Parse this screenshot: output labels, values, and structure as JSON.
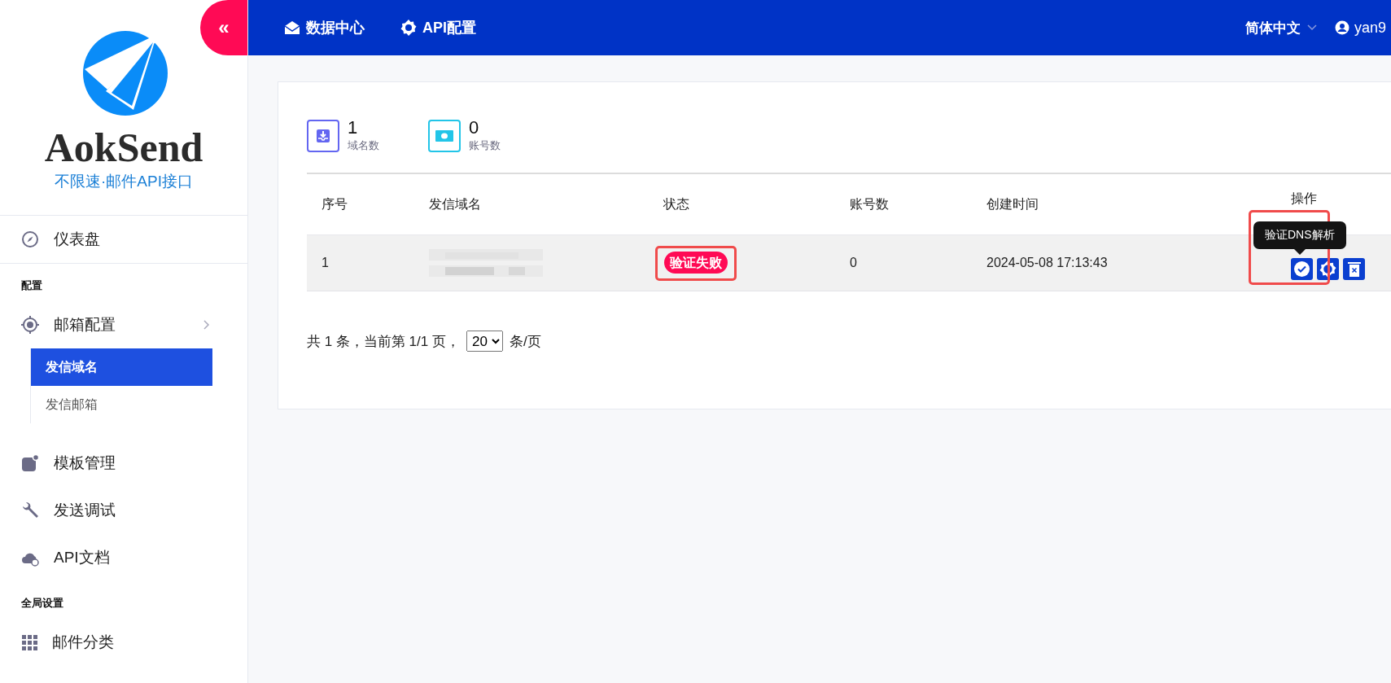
{
  "logo": {
    "name": "AokSend",
    "tagline": "不限速·邮件API接口"
  },
  "collapse_button": {
    "label": "«"
  },
  "top_nav": [
    {
      "label": "数据中心",
      "kind": "mail"
    },
    {
      "label": "API配置",
      "kind": "gear"
    }
  ],
  "language": {
    "label": "简体中文"
  },
  "user": {
    "name": "yan9"
  },
  "sidebar": [
    {
      "kind": "item",
      "label": "仪表盘",
      "bordered": true,
      "selected": false,
      "expandable": false
    },
    {
      "kind": "section",
      "label": "配置"
    },
    {
      "kind": "item",
      "label": "邮箱配置",
      "bordered": false,
      "selected": false,
      "expandable": true,
      "children": [
        {
          "label": "发信域名",
          "selected": true
        },
        {
          "label": "发信邮箱",
          "selected": false
        }
      ]
    },
    {
      "kind": "item",
      "label": "模板管理",
      "bordered": false,
      "selected": false,
      "expandable": false
    },
    {
      "kind": "item",
      "label": "发送调试",
      "bordered": false,
      "selected": false,
      "expandable": false
    },
    {
      "kind": "item",
      "label": "API文档",
      "bordered": false,
      "selected": false,
      "expandable": false
    },
    {
      "kind": "section",
      "label": "全局设置"
    },
    {
      "kind": "item",
      "label": "邮件分类",
      "bordered": false,
      "selected": false,
      "expandable": false
    }
  ],
  "stats": [
    {
      "value": "1",
      "label": "域名数",
      "kind": "inbox",
      "color": "#6366f1"
    },
    {
      "value": "0",
      "label": "账号数",
      "kind": "money",
      "color": "#22c5e8"
    }
  ],
  "table": {
    "columns": [
      "序号",
      "发信域名",
      "状态",
      "账号数",
      "创建时间",
      "操作"
    ],
    "rows": [
      {
        "index": "1",
        "status": "验证失败",
        "accounts": "0",
        "created": "2024-05-08 17:13:43"
      }
    ]
  },
  "tooltip": {
    "text": "验证DNS解析"
  },
  "pagination": {
    "summary": "共 1 条，当前第 1/1 页，",
    "page_size": "20",
    "unit": "条/页"
  }
}
